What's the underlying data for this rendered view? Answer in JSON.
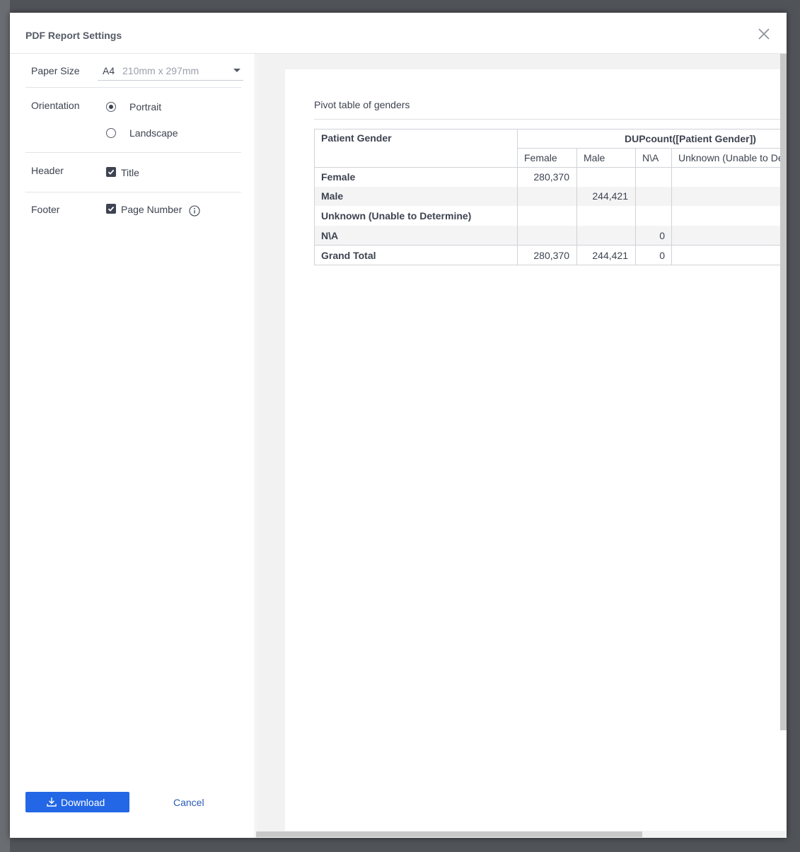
{
  "dialog": {
    "title": "PDF Report Settings",
    "close_icon": "close-icon"
  },
  "settings": {
    "paper_size": {
      "label": "Paper Size",
      "code": "A4",
      "dimensions": "210mm x 297mm"
    },
    "orientation": {
      "label": "Orientation",
      "options": [
        "Portrait",
        "Landscape"
      ],
      "selected": "Portrait"
    },
    "header": {
      "label": "Header",
      "option": "Title",
      "checked": true
    },
    "footer": {
      "label": "Footer",
      "option": "Page Number",
      "checked": true,
      "info_icon": "info-icon"
    }
  },
  "actions": {
    "download": "Download",
    "cancel": "Cancel"
  },
  "preview": {
    "title": "Pivot table of genders",
    "row_header": "Patient Gender",
    "measure": "DUPcount([Patient Gender])",
    "columns": [
      "Female",
      "Male",
      "N\\A",
      "Unknown (Unable to Determine)"
    ],
    "rows": [
      {
        "label": "Female",
        "values": [
          "280,370",
          "",
          "",
          ""
        ]
      },
      {
        "label": "Male",
        "values": [
          "",
          "244,421",
          "",
          ""
        ]
      },
      {
        "label": "Unknown (Unable to Determine)",
        "values": [
          "",
          "",
          "",
          ""
        ]
      },
      {
        "label": "N\\A",
        "values": [
          "",
          "",
          "0",
          ""
        ]
      }
    ],
    "grand_total": {
      "label": "Grand Total",
      "values": [
        "280,370",
        "244,421",
        "0",
        ""
      ]
    }
  },
  "colors": {
    "primary_button": "#2367e6",
    "link": "#2a5bb8",
    "text": "#3d4350"
  }
}
